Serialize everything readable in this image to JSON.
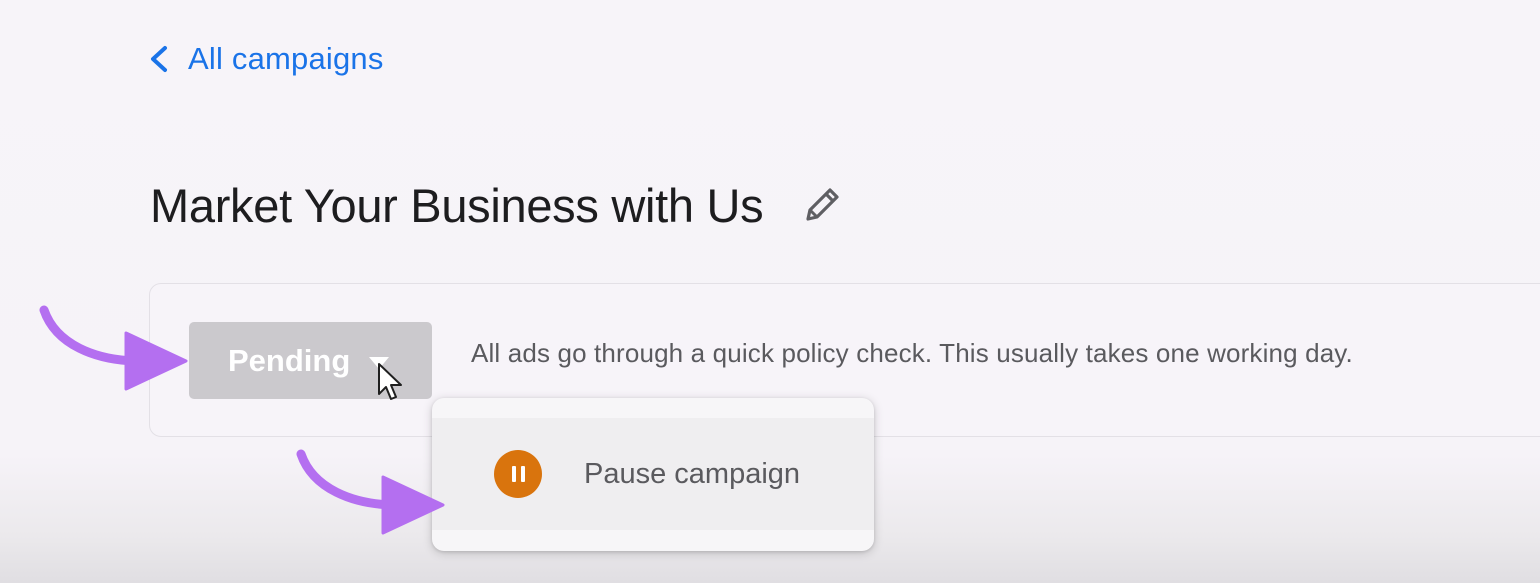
{
  "nav": {
    "back_label": "All campaigns"
  },
  "campaign": {
    "title": "Market Your Business with Us"
  },
  "status": {
    "label": "Pending",
    "description": "All ads go through a quick policy check. This usually takes one working day."
  },
  "menu": {
    "items": [
      {
        "label": "Pause campaign",
        "icon": "pause-circle-icon"
      }
    ]
  },
  "icons": {
    "back": "chevron-left-icon",
    "edit": "pencil-icon",
    "dropdown": "caret-down-icon",
    "annotation": "curved-arrow-icon",
    "cursor": "mouse-pointer-icon"
  },
  "colors": {
    "link": "#1a73e8",
    "title": "#1d1d1f",
    "body_text": "#5a5a5e",
    "status_bg": "#cbc9cd",
    "pause_icon": "#d9740d",
    "annotation": "#b46ff0",
    "background": "#f7f4f9"
  }
}
